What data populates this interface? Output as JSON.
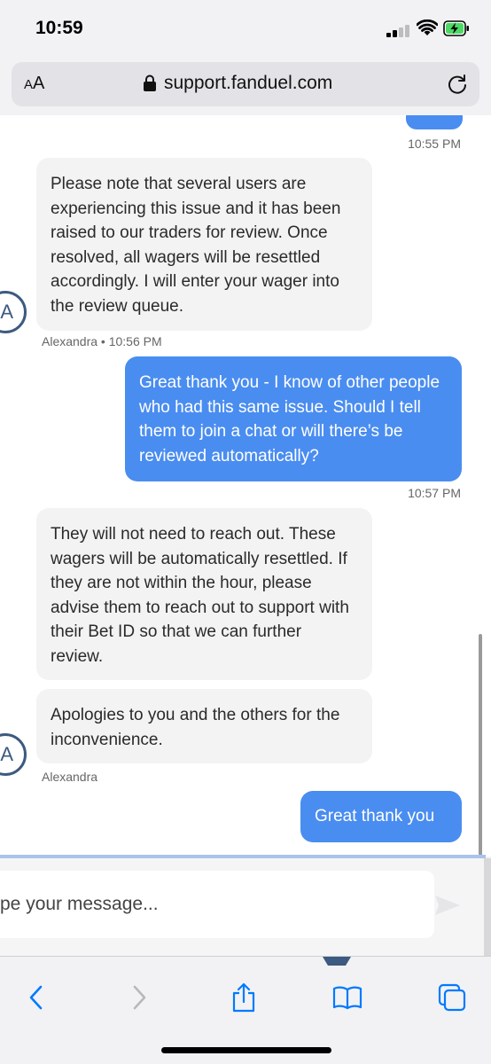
{
  "status_bar": {
    "time": "10:59"
  },
  "url_bar": {
    "aa_label_big": "A",
    "aa_label_small": "A",
    "url": "support.fanduel.com"
  },
  "messages": [
    {
      "sender": "user_partial",
      "time": "10:55 PM"
    },
    {
      "sender": "agent",
      "text": "Please note that several users are experiencing this issue and it has been raised to our traders for review. Once resolved, all wagers will be resettled accordingly. I will enter your wager into the review queue.",
      "meta": "Alexandra • 10:56 PM"
    },
    {
      "sender": "user",
      "text": "Great thank you - I know of other people who had this same issue. Should I tell them to join a chat or will there’s be reviewed automatically?",
      "time": "10:57 PM"
    },
    {
      "sender": "agent",
      "text": "They will not need to reach out. These wagers will be automatically resettled. If they are not within the hour, please advise them to reach out to support with their Bet ID so that we can further review."
    },
    {
      "sender": "agent",
      "text": "Apologies to you and the others for the inconvenience.",
      "meta": "Alexandra"
    },
    {
      "sender": "user",
      "text": "Great thank you"
    }
  ],
  "avatar": {
    "initial": "A"
  },
  "compose": {
    "placeholder": "pe your message..."
  },
  "colors": {
    "user_bubble": "#4a8df0",
    "agent_bubble": "#f3f3f4",
    "accent": "#007aff"
  },
  "toolbar": {
    "icons": [
      "back-icon",
      "forward-icon",
      "share-icon",
      "bookmarks-icon",
      "tabs-icon"
    ]
  }
}
